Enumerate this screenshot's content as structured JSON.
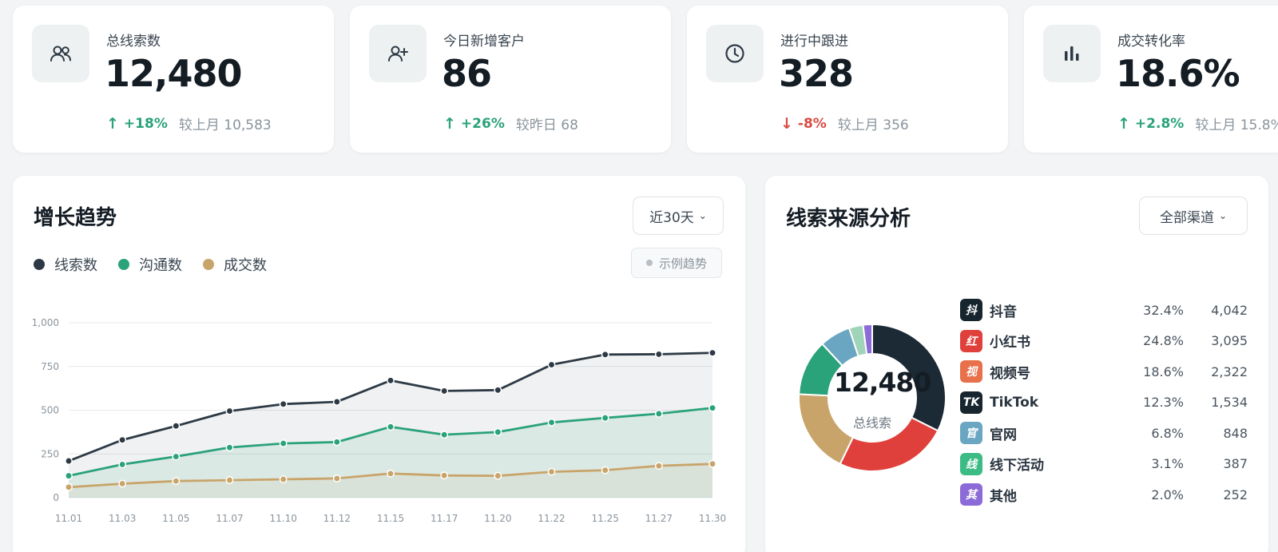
{
  "kpis": [
    {
      "label": "总线索数",
      "value": "12,480",
      "arrow": "↑",
      "delta": "+18%",
      "compare": "较上月 10,583",
      "direction": "up",
      "icon": "users-icon"
    },
    {
      "label": "今日新增客户",
      "value": "86",
      "arrow": "↑",
      "delta": "+26%",
      "compare": "较昨日 68",
      "direction": "up",
      "icon": "user-plus-icon"
    },
    {
      "label": "进行中跟进",
      "value": "328",
      "arrow": "↓",
      "delta": "-8%",
      "compare": "较上月 356",
      "direction": "down",
      "icon": "clock-icon"
    },
    {
      "label": "成交转化率",
      "value": "18.6%",
      "arrow": "↑",
      "delta": "+2.8%",
      "compare": "较上月 15.8%",
      "direction": "up",
      "icon": "bar-chart-icon"
    }
  ],
  "trend": {
    "title": "增长趋势",
    "range_select": "近30天",
    "example_badge": "示例趋势",
    "legend": [
      {
        "label": "线索数",
        "color": "#2d3a45"
      },
      {
        "label": "沟通数",
        "color": "#2aa27a"
      },
      {
        "label": "成交数",
        "color": "#c9a46a"
      }
    ]
  },
  "sources": {
    "title": "线索来源分析",
    "channel_select": "全部渠道",
    "center_value": "12,480",
    "center_label": "总线索",
    "items": [
      {
        "badge": "抖",
        "name": "抖音",
        "pct": "32.4%",
        "count": "4,042",
        "color": "#17252f"
      },
      {
        "badge": "红",
        "name": "小红书",
        "pct": "24.8%",
        "count": "3,095",
        "color": "#e0403c"
      },
      {
        "badge": "视",
        "name": "视频号",
        "pct": "18.6%",
        "count": "2,322",
        "color": "#e8704a"
      },
      {
        "badge": "TK",
        "name": "TikTok",
        "pct": "12.3%",
        "count": "1,534",
        "color": "#17252f"
      },
      {
        "badge": "官",
        "name": "官网",
        "pct": "6.8%",
        "count": "848",
        "color": "#6aa6c2"
      },
      {
        "badge": "线",
        "name": "线下活动",
        "pct": "3.1%",
        "count": "387",
        "color": "#3dbb85"
      },
      {
        "badge": "其",
        "name": "其他",
        "pct": "2.0%",
        "count": "252",
        "color": "#8c6bd8"
      }
    ]
  },
  "chart_data": [
    {
      "type": "line",
      "title": "增长趋势",
      "x": [
        "11.01",
        "11.03",
        "11.05",
        "11.07",
        "11.10",
        "11.12",
        "11.15",
        "11.17",
        "11.20",
        "11.22",
        "11.25",
        "11.27",
        "11.30"
      ],
      "ylim": [
        0,
        1000
      ],
      "yticks": [
        "0",
        "250",
        "500",
        "750",
        "1,000"
      ],
      "grid": true,
      "legend": "top-left",
      "series": [
        {
          "name": "线索数",
          "color": "#2d3a45",
          "values": [
            210,
            330,
            410,
            495,
            535,
            548,
            670,
            610,
            615,
            760,
            818,
            820,
            828
          ]
        },
        {
          "name": "沟通数",
          "color": "#2aa27a",
          "values": [
            125,
            190,
            235,
            287,
            310,
            318,
            405,
            360,
            375,
            430,
            456,
            480,
            513
          ]
        },
        {
          "name": "成交数",
          "color": "#c9a46a",
          "values": [
            60,
            80,
            95,
            100,
            105,
            110,
            138,
            127,
            125,
            148,
            157,
            182,
            193
          ]
        }
      ]
    },
    {
      "type": "pie",
      "categories": [
        "抖音",
        "小红书",
        "视频号",
        "TikTok",
        "官网",
        "线下活动",
        "其他"
      ],
      "values": [
        32.4,
        24.8,
        18.6,
        12.3,
        6.8,
        3.1,
        2.0
      ],
      "slice_colors": [
        "#1c2a35",
        "#e0403c",
        "#c9a46a",
        "#2aa27a",
        "#6aa6c2",
        "#9fd4b8",
        "#8c6bd8"
      ]
    }
  ]
}
